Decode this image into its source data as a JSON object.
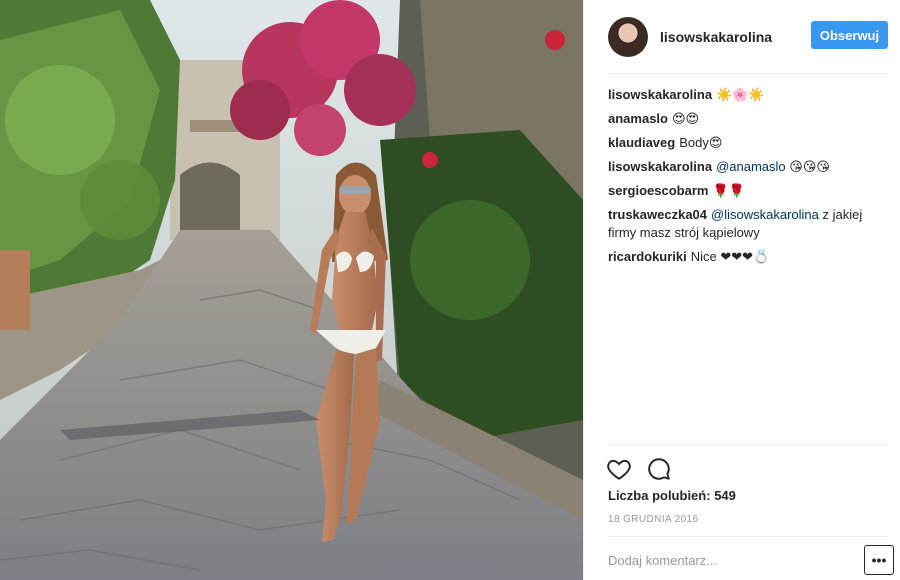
{
  "post": {
    "username": "lisowskakarolina",
    "follow_label": "Obserwuj",
    "comments": [
      {
        "user": "lisowskakarolina",
        "text": "☀️🌸☀️"
      },
      {
        "user": "anamaslo",
        "text": "😍😍"
      },
      {
        "user": "klaudiaveg",
        "text": "Body😍"
      },
      {
        "user": "lisowskakarolina",
        "mention": "@anamaslo",
        "text": "😘😘😘"
      },
      {
        "user": "sergioescobarm",
        "text": "🌹🌹"
      },
      {
        "user": "truskaweczka04",
        "mention": "@lisowskakarolina",
        "text": "z jakiej firmy masz strój kąpielowy"
      },
      {
        "user": "ricardokuriki",
        "text": "Nice ❤❤❤💍"
      }
    ],
    "likes_label": "Liczba polubień:",
    "likes_count": "549",
    "date": "18 GRUDNIA 2016",
    "add_comment_placeholder": "Dodaj komentarz...",
    "more_label": "•••"
  },
  "colors": {
    "accent": "#3897f0",
    "text": "#262626",
    "muted": "#999999",
    "mention": "#003569"
  },
  "icons": [
    "heart-icon",
    "comment-icon",
    "more-options-icon"
  ]
}
